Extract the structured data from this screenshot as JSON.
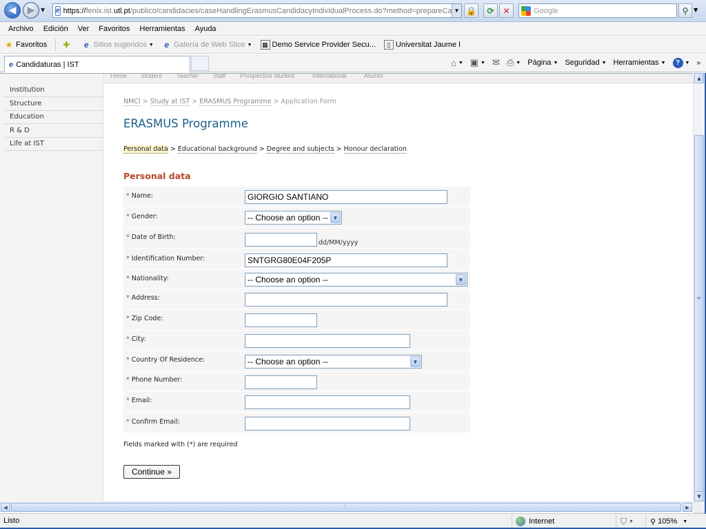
{
  "browser": {
    "address": {
      "scheme": "https://",
      "host_pre": "fenix.ist.",
      "host_main": "utl.pt",
      "path": "/publico/candidacies/caseHandlingErasmusCandidacyIndividualProcess.do?method=prepareCandidacyCrea"
    },
    "search_placeholder": "Google",
    "menu": [
      "Archivo",
      "Edición",
      "Ver",
      "Favoritos",
      "Herramientas",
      "Ayuda"
    ],
    "favorites": {
      "label": "Favoritos",
      "suggested": "Sitios sugeridos",
      "web_slice": "Galería de Web Slice",
      "demo": "Demo Service Provider Secu...",
      "uji": "Universitat Jaume I"
    },
    "tab_title": "Candidaturas | IST",
    "commands": {
      "page": "Página",
      "security": "Seguridad",
      "tools": "Herramientas"
    },
    "status": {
      "text": "Listo",
      "zone": "Internet",
      "zoom": "105%"
    },
    "icons": [
      "back-icon",
      "forward-icon",
      "lock-icon",
      "refresh-icon",
      "stop-icon",
      "search-icon",
      "star-icon",
      "home-icon",
      "feed-icon",
      "mail-icon",
      "print-icon",
      "help-icon",
      "globe-icon"
    ]
  },
  "site": {
    "top_nav": [
      "Home",
      "Student",
      "Teacher",
      "Staff",
      "Prospective student",
      "International",
      "Alumni"
    ],
    "sidebar": [
      "Institution",
      "Structure",
      "Education",
      "R & D",
      "Life at IST"
    ],
    "breadcrumb": [
      "NMCI",
      "Study at IST",
      "ERASMUS Programme",
      "Application Form"
    ],
    "title": "ERASMUS Programme",
    "steps": [
      "Personal data",
      "Educational background",
      "Degree and subjects",
      "Honour declaration"
    ],
    "section_title": "Personal data",
    "form": {
      "name_label": "Name:",
      "name_value": "GIORGIO SANTIANO",
      "gender_label": "Gender:",
      "gender_value": "-- Choose an option --",
      "dob_label": "Date of Birth:",
      "dob_value": "",
      "dob_hint": "dd/MM/yyyy",
      "id_label": "Identification Number:",
      "id_value": "SNTGRG80E04F205P",
      "nationality_label": "Nationality:",
      "nationality_value": "-- Choose an option --",
      "address_label": "Address:",
      "address_value": "",
      "zip_label": "Zip Code:",
      "zip_value": "",
      "city_label": "City:",
      "city_value": "",
      "country_label": "Country Of Residence:",
      "country_value": "-- Choose an option --",
      "phone_label": "Phone Number:",
      "phone_value": "",
      "email_label": "Email:",
      "email_value": "",
      "confirm_email_label": "Confirm Email:",
      "confirm_email_value": ""
    },
    "required_star": "*",
    "required_note": "Fields marked with (*) are required",
    "continue_label": "Continue »"
  }
}
